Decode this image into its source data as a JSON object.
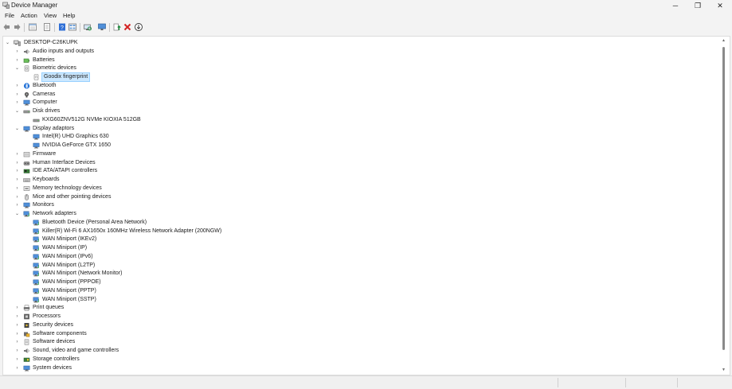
{
  "window": {
    "title": "Device Manager",
    "app_icon": "device-manager-icon",
    "minimize": "─",
    "maximize": "❐",
    "close": "✕"
  },
  "menu": [
    "File",
    "Action",
    "View",
    "Help"
  ],
  "toolbar": [
    "back-icon",
    "forward-icon",
    "properties-window-icon",
    "properties-icon",
    "help-icon",
    "view-icon",
    "scan-hardware-icon",
    "monitor-icon",
    "update-driver-icon",
    "uninstall-icon",
    "download-icon"
  ],
  "tree": {
    "root": "DESKTOP-C26KUPK",
    "rows": [
      {
        "label": "Audio inputs and outputs",
        "icon": "speaker-icon",
        "level": 1,
        "state": "collapsed"
      },
      {
        "label": "Batteries",
        "icon": "battery-icon",
        "level": 1,
        "state": "collapsed"
      },
      {
        "label": "Biometric devices",
        "icon": "biometric-icon",
        "level": 1,
        "state": "expanded"
      },
      {
        "label": "Goodix fingerprint",
        "icon": "fingerprint-icon",
        "level": 2,
        "state": "leaf",
        "selected": true
      },
      {
        "label": "Bluetooth",
        "icon": "bluetooth-icon",
        "level": 1,
        "state": "collapsed"
      },
      {
        "label": "Cameras",
        "icon": "camera-icon",
        "level": 1,
        "state": "collapsed"
      },
      {
        "label": "Computer",
        "icon": "computer-icon",
        "level": 1,
        "state": "collapsed"
      },
      {
        "label": "Disk drives",
        "icon": "disk-icon",
        "level": 1,
        "state": "expanded"
      },
      {
        "label": "KXG60ZNV512G NVMe KIOXIA 512GB",
        "icon": "disk-icon",
        "level": 2,
        "state": "leaf"
      },
      {
        "label": "Display adaptors",
        "icon": "display-icon",
        "level": 1,
        "state": "expanded"
      },
      {
        "label": "Intel(R) UHD Graphics 630",
        "icon": "display-icon",
        "level": 2,
        "state": "leaf"
      },
      {
        "label": "NVIDIA GeForce GTX 1650",
        "icon": "display-icon",
        "level": 2,
        "state": "leaf"
      },
      {
        "label": "Firmware",
        "icon": "firmware-icon",
        "level": 1,
        "state": "collapsed"
      },
      {
        "label": "Human Interface Devices",
        "icon": "hid-icon",
        "level": 1,
        "state": "collapsed"
      },
      {
        "label": "IDE ATA/ATAPI controllers",
        "icon": "ide-controller-icon",
        "level": 1,
        "state": "collapsed"
      },
      {
        "label": "Keyboards",
        "icon": "keyboard-icon",
        "level": 1,
        "state": "collapsed"
      },
      {
        "label": "Memory technology devices",
        "icon": "memory-icon",
        "level": 1,
        "state": "collapsed"
      },
      {
        "label": "Mice and other pointing devices",
        "icon": "mouse-icon",
        "level": 1,
        "state": "collapsed"
      },
      {
        "label": "Monitors",
        "icon": "monitor-icon",
        "level": 1,
        "state": "collapsed"
      },
      {
        "label": "Network adapters",
        "icon": "network-icon",
        "level": 1,
        "state": "expanded"
      },
      {
        "label": "Bluetooth Device (Personal Area Network)",
        "icon": "network-icon",
        "level": 2,
        "state": "leaf"
      },
      {
        "label": "Killer(R) Wi-Fi 6 AX1650x 160MHz Wireless Network Adapter (200NGW)",
        "icon": "network-icon",
        "level": 2,
        "state": "leaf"
      },
      {
        "label": "WAN Miniport (IKEv2)",
        "icon": "network-icon",
        "level": 2,
        "state": "leaf"
      },
      {
        "label": "WAN Miniport (IP)",
        "icon": "network-icon",
        "level": 2,
        "state": "leaf"
      },
      {
        "label": "WAN Miniport (IPv6)",
        "icon": "network-icon",
        "level": 2,
        "state": "leaf"
      },
      {
        "label": "WAN Miniport (L2TP)",
        "icon": "network-icon",
        "level": 2,
        "state": "leaf"
      },
      {
        "label": "WAN Miniport (Network Monitor)",
        "icon": "network-icon",
        "level": 2,
        "state": "leaf"
      },
      {
        "label": "WAN Miniport (PPPOE)",
        "icon": "network-icon",
        "level": 2,
        "state": "leaf"
      },
      {
        "label": "WAN Miniport (PPTP)",
        "icon": "network-icon",
        "level": 2,
        "state": "leaf"
      },
      {
        "label": "WAN Miniport (SSTP)",
        "icon": "network-icon",
        "level": 2,
        "state": "leaf"
      },
      {
        "label": "Print queues",
        "icon": "printer-icon",
        "level": 1,
        "state": "collapsed"
      },
      {
        "label": "Processors",
        "icon": "processor-icon",
        "level": 1,
        "state": "collapsed"
      },
      {
        "label": "Security devices",
        "icon": "security-icon",
        "level": 1,
        "state": "collapsed"
      },
      {
        "label": "Software components",
        "icon": "software-component-icon",
        "level": 1,
        "state": "collapsed"
      },
      {
        "label": "Software devices",
        "icon": "software-device-icon",
        "level": 1,
        "state": "collapsed"
      },
      {
        "label": "Sound, video and game controllers",
        "icon": "sound-icon",
        "level": 1,
        "state": "collapsed"
      },
      {
        "label": "Storage controllers",
        "icon": "storage-controller-icon",
        "level": 1,
        "state": "collapsed"
      },
      {
        "label": "System devices",
        "icon": "system-device-icon",
        "level": 1,
        "state": "collapsed"
      }
    ]
  },
  "colors": {
    "selection": "#cce8ff",
    "selection_border": "#99d1ff",
    "toolbar_blue": "#2f6fd6",
    "toolbar_green": "#1e8f3e",
    "uninstall_red": "#d32222"
  }
}
